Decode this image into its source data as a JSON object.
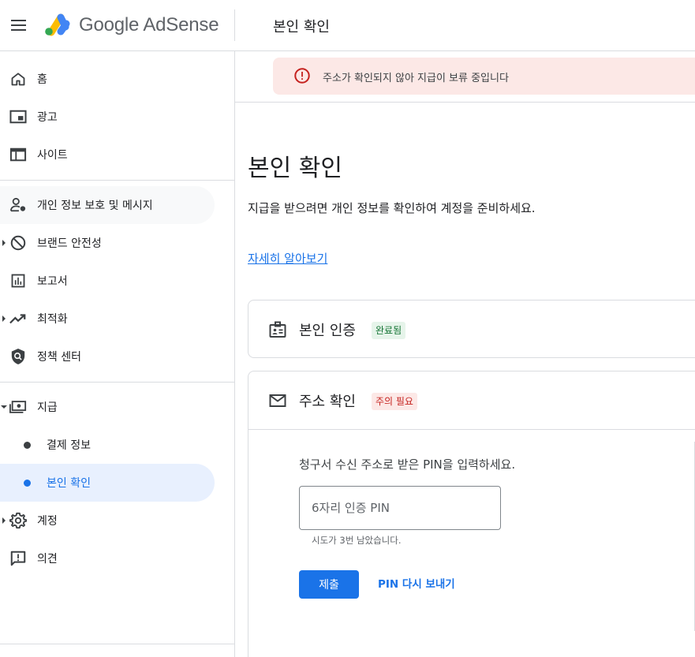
{
  "header": {
    "brand": "Google AdSense",
    "page_title": "본인 확인"
  },
  "sidebar": {
    "items": [
      {
        "label": "홈",
        "icon": "home-icon"
      },
      {
        "label": "광고",
        "icon": "ads-icon"
      },
      {
        "label": "사이트",
        "icon": "sites-icon"
      },
      {
        "label": "개인 정보 보호 및 메시지",
        "icon": "privacy-messaging-icon"
      },
      {
        "label": "브랜드 안전성",
        "icon": "block-icon"
      },
      {
        "label": "보고서",
        "icon": "reports-icon"
      },
      {
        "label": "최적화",
        "icon": "trending-up-icon"
      },
      {
        "label": "정책 센터",
        "icon": "policy-shield-icon"
      },
      {
        "label": "지급",
        "icon": "payments-icon"
      },
      {
        "label": "결제 정보"
      },
      {
        "label": "본인 확인"
      },
      {
        "label": "계정",
        "icon": "gear-icon"
      },
      {
        "label": "의견",
        "icon": "feedback-icon"
      }
    ]
  },
  "alert": {
    "text": "주소가 확인되지 않아 지급이 보류 중입니다"
  },
  "main": {
    "title": "본인 확인",
    "description": "지급을 받으려면 개인 정보를 확인하여 계정을 준비하세요.",
    "learn_more": "자세히 알아보기"
  },
  "identity_card": {
    "title": "본인 인증",
    "status": "완료됨"
  },
  "address_card": {
    "title": "주소 확인",
    "status": "주의 필요",
    "prompt": "청구서 수신 주소로 받은 PIN을 입력하세요.",
    "pin_placeholder": "6자리 인증 PIN",
    "attempts": "시도가 3번 남았습니다.",
    "submit_label": "제출",
    "resend_label": "PIN 다시 보내기"
  },
  "colors": {
    "accent": "#1a73e8",
    "error": "#c5221f",
    "success": "#137333"
  }
}
